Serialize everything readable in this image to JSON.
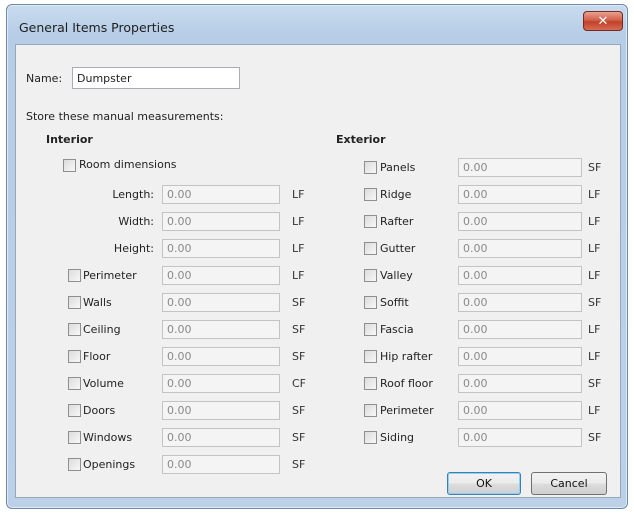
{
  "dialog": {
    "title": "General Items Properties",
    "close_glyph": "✕",
    "name_label": "Name:",
    "name_value": "Dumpster",
    "store_label": "Store these manual measurements:",
    "ok_label": "OK",
    "cancel_label": "Cancel"
  },
  "interior": {
    "heading": "Interior",
    "room_label": "Room dimensions",
    "room_fields": [
      {
        "label": "Length:",
        "value": "0.00",
        "unit": "LF"
      },
      {
        "label": "Width:",
        "value": "0.00",
        "unit": "LF"
      },
      {
        "label": "Height:",
        "value": "0.00",
        "unit": "LF"
      }
    ],
    "items": [
      {
        "label": "Perimeter",
        "value": "0.00",
        "unit": "LF"
      },
      {
        "label": "Walls",
        "value": "0.00",
        "unit": "SF"
      },
      {
        "label": "Ceiling",
        "value": "0.00",
        "unit": "SF"
      },
      {
        "label": "Floor",
        "value": "0.00",
        "unit": "SF"
      },
      {
        "label": "Volume",
        "value": "0.00",
        "unit": "CF"
      },
      {
        "label": "Doors",
        "value": "0.00",
        "unit": "SF"
      },
      {
        "label": "Windows",
        "value": "0.00",
        "unit": "SF"
      },
      {
        "label": "Openings",
        "value": "0.00",
        "unit": "SF"
      }
    ]
  },
  "exterior": {
    "heading": "Exterior",
    "items": [
      {
        "label": "Panels",
        "value": "0.00",
        "unit": "SF"
      },
      {
        "label": "Ridge",
        "value": "0.00",
        "unit": "LF"
      },
      {
        "label": "Rafter",
        "value": "0.00",
        "unit": "LF"
      },
      {
        "label": "Gutter",
        "value": "0.00",
        "unit": "LF"
      },
      {
        "label": "Valley",
        "value": "0.00",
        "unit": "LF"
      },
      {
        "label": "Soffit",
        "value": "0.00",
        "unit": "SF"
      },
      {
        "label": "Fascia",
        "value": "0.00",
        "unit": "LF"
      },
      {
        "label": "Hip rafter",
        "value": "0.00",
        "unit": "LF"
      },
      {
        "label": "Roof floor",
        "value": "0.00",
        "unit": "SF"
      },
      {
        "label": "Perimeter",
        "value": "0.00",
        "unit": "LF"
      },
      {
        "label": "Siding",
        "value": "0.00",
        "unit": "SF"
      }
    ]
  }
}
